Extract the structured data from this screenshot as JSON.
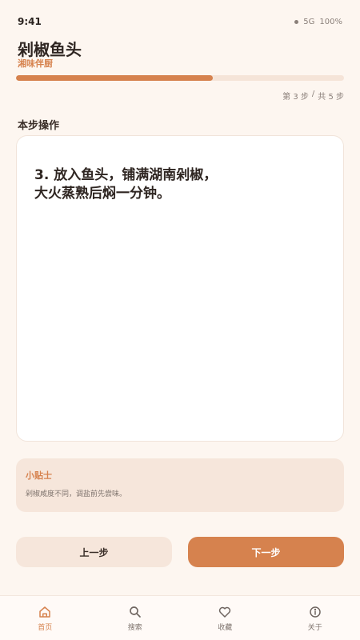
{
  "status_bar": {
    "time": "9:41",
    "network": "5G",
    "battery": "100%"
  },
  "header": {
    "title": "剁椒鱼头",
    "subtitle": "湘味伴厨"
  },
  "progress": {
    "fraction": 0.6,
    "current_label": "第 3 步",
    "separator": "/",
    "total_label": "共 5 步"
  },
  "step": {
    "section_label": "本步操作",
    "instruction": "3. 放入鱼头，铺满湖南剁椒，\n大火蒸熟后焖一分钟。"
  },
  "tip": {
    "title": "小贴士",
    "text": "剁椒咸度不同，调盐前先尝味。"
  },
  "buttons": {
    "prev_label": "上一步",
    "next_label": "下一步"
  },
  "tabs": [
    {
      "label": "首页",
      "icon": "home-icon",
      "active": true
    },
    {
      "label": "搜索",
      "icon": "search-icon",
      "active": false
    },
    {
      "label": "收藏",
      "icon": "heart-icon",
      "active": false
    },
    {
      "label": "关于",
      "icon": "info-icon",
      "active": false
    }
  ],
  "colors": {
    "accent": "#d6824e",
    "background": "#fdf6f0",
    "tip_background": "#f6e6db"
  }
}
